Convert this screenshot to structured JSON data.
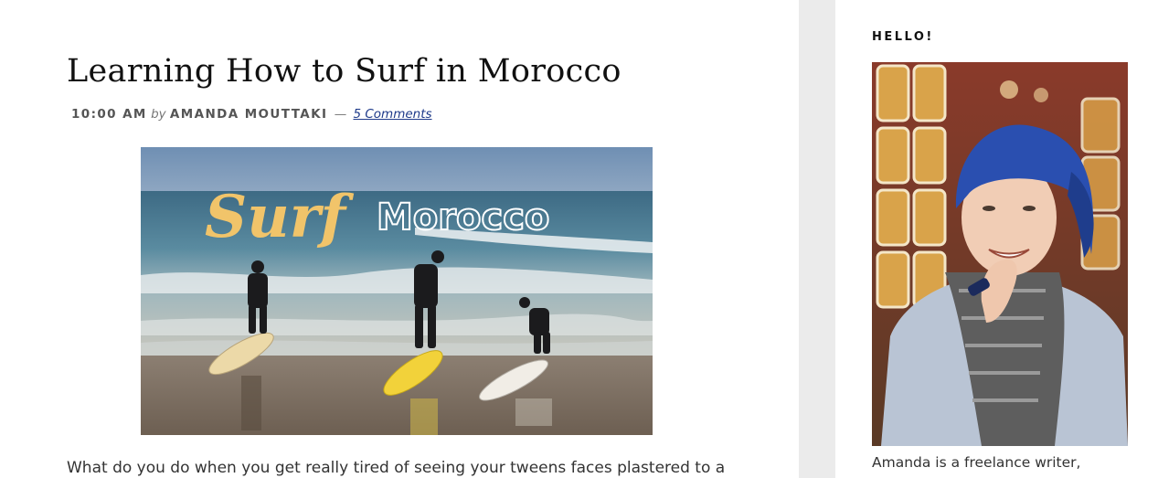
{
  "post": {
    "title": "Learning How to Surf in Morocco",
    "meta": {
      "time": "10:00 AM",
      "by": "by",
      "author": "AMANDA MOUTTAKI",
      "separator": "—",
      "comments": "5 Comments"
    },
    "featured_image": {
      "overlay_word_1": "Surf",
      "overlay_word_2": "Morocco"
    },
    "excerpt": "What do you do when you get really tired of seeing your tweens faces plastered to a"
  },
  "sidebar": {
    "widget_title": "HELLO!",
    "bio": "Amanda is a freelance writer,"
  },
  "colors": {
    "gutter": "#ebebeb",
    "link": "#1e3a8a",
    "surf_text": "#f1c46a",
    "headscarf": "#2a4fb0"
  }
}
